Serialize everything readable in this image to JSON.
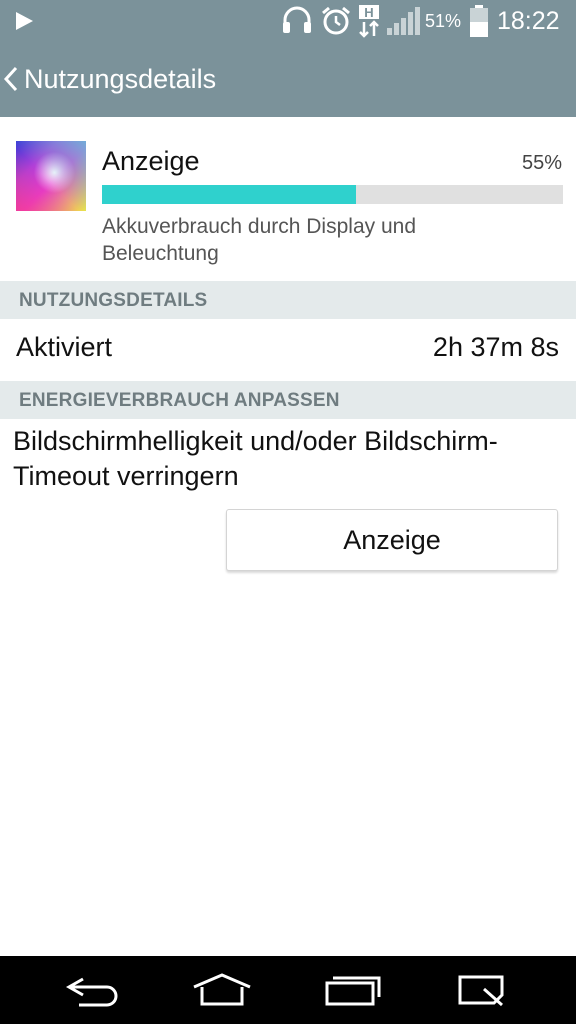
{
  "status_bar": {
    "icons": [
      "play-icon",
      "headset-icon",
      "alarm-icon",
      "hspa-data-icon",
      "signal-icon",
      "battery-icon"
    ],
    "battery_percent": "51%",
    "time": "18:22"
  },
  "header": {
    "title": "Nutzungsdetails"
  },
  "app": {
    "name": "Anzeige",
    "percent_label": "55%",
    "usage_fraction": 0.55,
    "description": "Akkuverbrauch durch Display und Beleuchtung"
  },
  "usage_section": {
    "title": "NUTZUNGSDETAILS",
    "row_label": "Aktiviert",
    "row_value": "2h 37m 8s"
  },
  "energy_section": {
    "title": "ENERGIEVERBRAUCH ANPASSEN",
    "tip": "Bildschirmhelligkeit und/oder Bildschirm-Timeout verringern",
    "button_label": "Anzeige"
  },
  "nav_bar": {
    "buttons": [
      "back-icon",
      "home-icon",
      "recent-apps-icon",
      "quick-memo-icon"
    ]
  },
  "colors": {
    "header_bg": "#7b929a",
    "accent": "#2fd1cd",
    "section_bg": "#e4eaeb"
  }
}
